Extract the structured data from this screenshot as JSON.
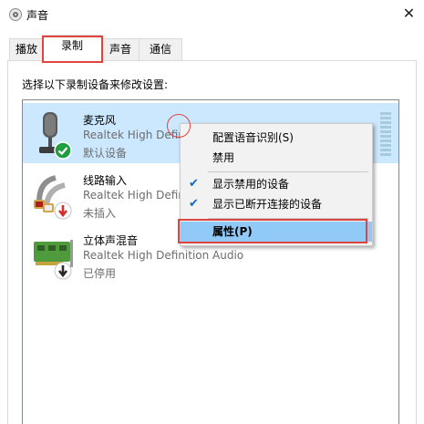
{
  "window": {
    "title": "声音",
    "close_glyph": "✕"
  },
  "tabs": [
    {
      "label": "播放",
      "active": false
    },
    {
      "label": "录制",
      "active": true
    },
    {
      "label": "声音",
      "active": false
    },
    {
      "label": "通信",
      "active": false
    }
  ],
  "instruction": "选择以下录制设备来修改设置:",
  "devices": [
    {
      "name": "麦克风",
      "line2": "Realtek High Defin",
      "line3": "默认设备",
      "icon": "microphone-icon",
      "status": "default-check",
      "selected": true
    },
    {
      "name": "线路输入",
      "line2": "Realtek High Defin",
      "line3": "未插入",
      "icon": "line-in-icon",
      "status": "unplugged"
    },
    {
      "name": "立体声混音",
      "line2": "Realtek High Definition Audio",
      "line3": "已停用",
      "icon": "sound-card-icon",
      "status": "disabled"
    }
  ],
  "context_menu": {
    "items": [
      {
        "label": "配置语音识别(S)",
        "checked": false
      },
      {
        "label": "禁用",
        "checked": false
      },
      {
        "label": "显示禁用的设备",
        "checked": true
      },
      {
        "label": "显示已断开连接的设备",
        "checked": true
      },
      {
        "label": "属性(P)",
        "checked": false,
        "selected": true
      }
    ],
    "check_glyph": "✔"
  },
  "colors": {
    "highlight": "#e0443f",
    "selected_row": "#cce8ff",
    "menu_selected": "#91c9f7",
    "check_green": "#1e9e3f"
  }
}
